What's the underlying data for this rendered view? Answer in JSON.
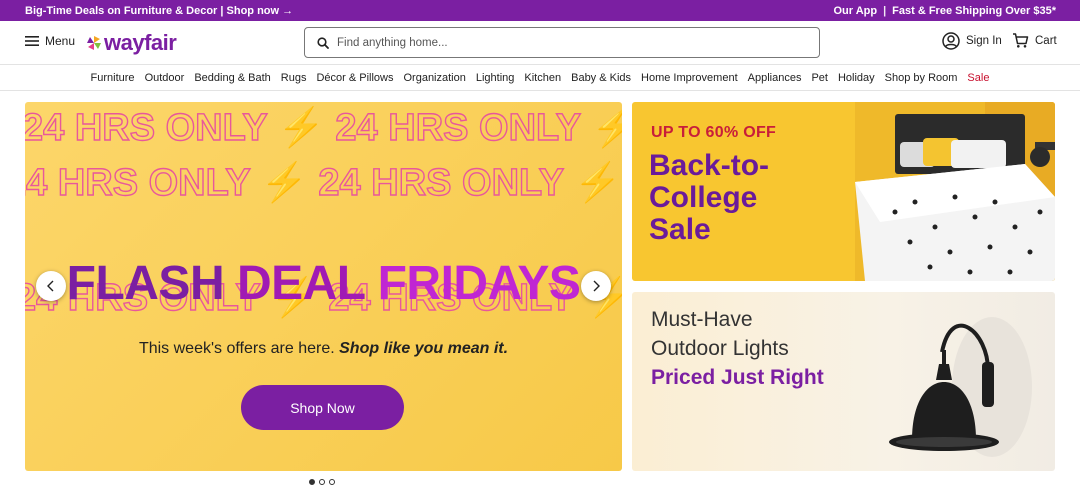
{
  "promo": {
    "left": "Big-Time Deals on Furniture & Decor | Shop now →",
    "app": "Our App",
    "sep": "|",
    "shipping": "Fast & Free Shipping Over $35*"
  },
  "header": {
    "menu_label": "Menu",
    "logo_text": "wayfair",
    "search_placeholder": "Find anything home...",
    "signin_label": "Sign In",
    "cart_label": "Cart"
  },
  "nav": {
    "items": [
      "Furniture",
      "Outdoor",
      "Bedding & Bath",
      "Rugs",
      "Décor & Pillows",
      "Organization",
      "Lighting",
      "Kitchen",
      "Baby & Kids",
      "Home Improvement",
      "Appliances",
      "Pet",
      "Holiday",
      "Shop by Room",
      "Sale"
    ]
  },
  "hero": {
    "pattern_text": "24 HRS ONLY",
    "headline_1": "FLASH",
    "headline_2": "DEAL",
    "headline_3": "FRIDAYS",
    "sub_plain": "This week's offers are here. ",
    "sub_bold": "Shop like you mean it.",
    "cta": "Shop Now",
    "slides_total": 3,
    "slide_active": 1
  },
  "card_college": {
    "discount": "UP TO 60% OFF",
    "title_1": "Back-to-",
    "title_2": "College",
    "title_3": "Sale"
  },
  "card_lights": {
    "line_1": "Must-Have",
    "line_2": "Outdoor Lights",
    "line_3": "Priced Just Right"
  },
  "colors": {
    "brand_purple": "#7b1fa2",
    "sale_red": "#c8102e",
    "hero_yellow": "#fcd34d",
    "pattern_pink": "#e8579b"
  }
}
